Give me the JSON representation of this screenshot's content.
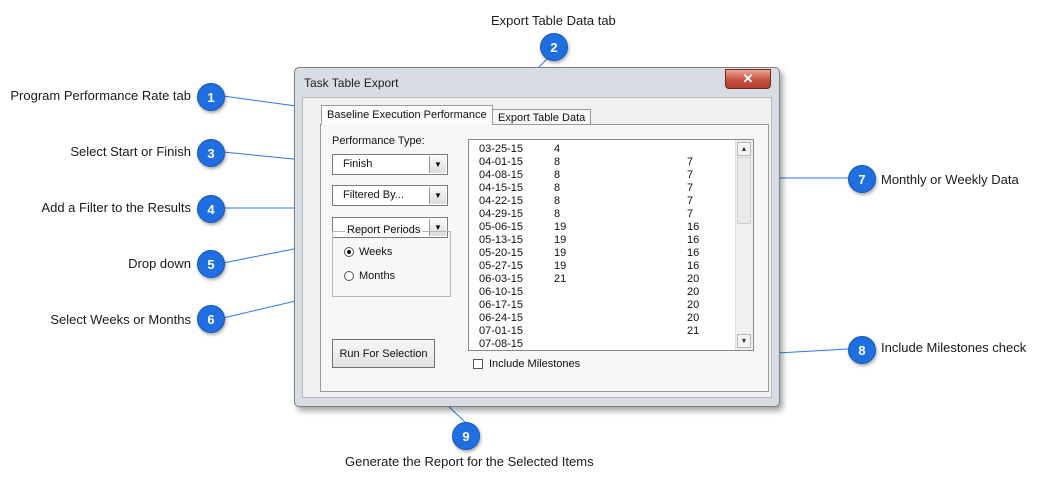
{
  "callouts": [
    {
      "num": "1",
      "text": "Program Performance Rate tab"
    },
    {
      "num": "2",
      "text": "Export Table Data tab"
    },
    {
      "num": "3",
      "text": "Select Start or Finish"
    },
    {
      "num": "4",
      "text": "Add a Filter to the Results"
    },
    {
      "num": "5",
      "text": "Drop down"
    },
    {
      "num": "6",
      "text": "Select Weeks or Months"
    },
    {
      "num": "7",
      "text": "Monthly or Weekly Data"
    },
    {
      "num": "8",
      "text": "Include Milestones check"
    },
    {
      "num": "9",
      "text": "Generate the Report for the Selected Items"
    }
  ],
  "dialog": {
    "title": "Task Table Export",
    "close_glyph": "✕",
    "tabs": [
      "Baseline Execution Performance",
      "Export Table Data"
    ],
    "performance_type_label": "Performance Type:",
    "performance_type_value": "Finish",
    "filter_value": "Filtered By...",
    "third_dropdown_value": "",
    "report_periods": {
      "title": "Report Periods",
      "options": [
        "Weeks",
        "Months"
      ],
      "selected": "Weeks"
    },
    "run_button": "Run For Selection",
    "include_milestones": {
      "label": "Include Milestones",
      "checked": false
    },
    "rows": [
      [
        "03-25-15",
        "4",
        ""
      ],
      [
        "04-01-15",
        "8",
        "7"
      ],
      [
        "04-08-15",
        "8",
        "7"
      ],
      [
        "04-15-15",
        "8",
        "7"
      ],
      [
        "04-22-15",
        "8",
        "7"
      ],
      [
        "04-29-15",
        "8",
        "7"
      ],
      [
        "05-06-15",
        "19",
        "16"
      ],
      [
        "05-13-15",
        "19",
        "16"
      ],
      [
        "05-20-15",
        "19",
        "16"
      ],
      [
        "05-27-15",
        "19",
        "16"
      ],
      [
        "06-03-15",
        "21",
        "20"
      ],
      [
        "06-10-15",
        "",
        "20"
      ],
      [
        "06-17-15",
        "",
        "20"
      ],
      [
        "06-24-15",
        "",
        "20"
      ],
      [
        "07-01-15",
        "",
        "21"
      ],
      [
        "07-08-15",
        "",
        ""
      ]
    ]
  }
}
